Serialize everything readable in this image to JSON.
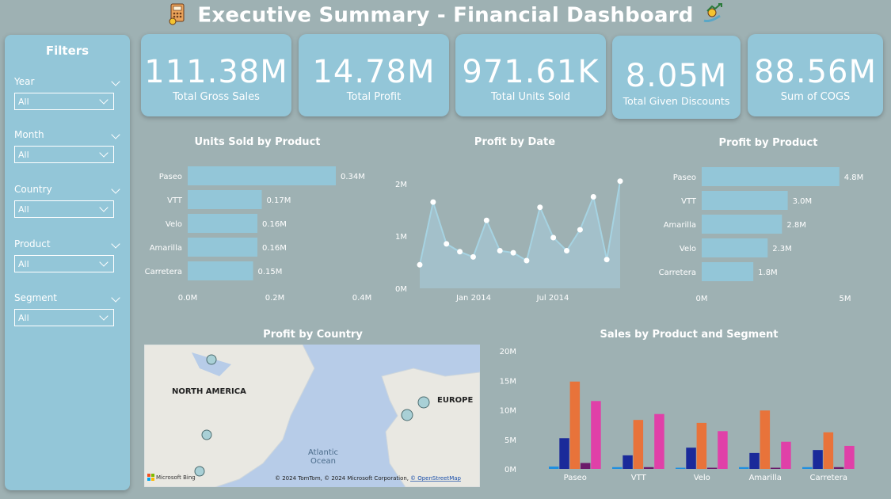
{
  "header": {
    "title": "Executive Summary - Financial Dashboard"
  },
  "filters": {
    "title": "Filters",
    "items": [
      {
        "label": "Year",
        "value": "All"
      },
      {
        "label": "Month",
        "value": "All"
      },
      {
        "label": "Country",
        "value": "All"
      },
      {
        "label": "Product",
        "value": "All"
      },
      {
        "label": "Segment",
        "value": "All"
      }
    ]
  },
  "kpis": [
    {
      "value": "111.38M",
      "label": "Total Gross Sales"
    },
    {
      "value": "14.78M",
      "label": "Total Profit"
    },
    {
      "value": "971.61K",
      "label": "Total Units Sold"
    },
    {
      "value": "8.05M",
      "label": "Total Given Discounts"
    },
    {
      "value": "88.56M",
      "label": "Sum of COGS"
    }
  ],
  "colors": {
    "bar": "#93c6d8",
    "card": "#93c6d8",
    "background": "#9eb1b3",
    "segments": [
      "#1f8fe0",
      "#1a2a9a",
      "#e8733a",
      "#6b1a6a",
      "#e040a8"
    ]
  },
  "chart_data": [
    {
      "type": "bar",
      "orientation": "horizontal",
      "title": "Units Sold by Product",
      "categories": [
        "Paseo",
        "VTT",
        "Velo",
        "Amarilla",
        "Carretera"
      ],
      "values": [
        0.34,
        0.17,
        0.16,
        0.16,
        0.15
      ],
      "value_labels": [
        "0.34M",
        "0.17M",
        "0.16M",
        "0.16M",
        "0.15M"
      ],
      "xlim": [
        0,
        0.4
      ],
      "ticks": [
        "0.0M",
        "0.2M",
        "0.4M"
      ]
    },
    {
      "type": "area",
      "title": "Profit by Date",
      "values": [
        0.45,
        1.65,
        0.85,
        0.7,
        0.6,
        1.3,
        0.72,
        0.68,
        0.53,
        1.55,
        0.97,
        0.72,
        1.12,
        1.75,
        0.55,
        2.05
      ],
      "ylim": [
        0,
        2.2
      ],
      "yticks": [
        "0M",
        "1M",
        "2M"
      ],
      "xticks": [
        "Jan 2014",
        "Jul 2014"
      ]
    },
    {
      "type": "bar",
      "orientation": "horizontal",
      "title": "Profit by Product",
      "categories": [
        "Paseo",
        "VTT",
        "Amarilla",
        "Velo",
        "Carretera"
      ],
      "values": [
        4.8,
        3.0,
        2.8,
        2.3,
        1.8
      ],
      "value_labels": [
        "4.8M",
        "3.0M",
        "2.8M",
        "2.3M",
        "1.8M"
      ],
      "xlim": [
        0,
        5
      ],
      "ticks": [
        "0M",
        "5M"
      ]
    },
    {
      "type": "map",
      "title": "Profit by Country",
      "labels": [
        "NORTH AMERICA",
        "EUROPE",
        "Atlantic",
        "Ocean"
      ],
      "attribution": "© 2024 TomTom, © 2024 Microsoft Corporation,",
      "attribution_link": "© OpenStreetMap",
      "logo": "Microsoft Bing"
    },
    {
      "type": "bar",
      "title": "Sales by Product and Segment",
      "categories": [
        "Paseo",
        "VTT",
        "Velo",
        "Amarilla",
        "Carretera"
      ],
      "series": [
        {
          "values": [
            0.4,
            0.3,
            0.2,
            0.3,
            0.3
          ]
        },
        {
          "values": [
            5.2,
            2.3,
            3.6,
            2.7,
            3.2
          ]
        },
        {
          "values": [
            14.8,
            8.3,
            7.8,
            9.9,
            6.2
          ]
        },
        {
          "values": [
            1.0,
            0.3,
            0.2,
            0.2,
            0.3
          ]
        },
        {
          "values": [
            11.5,
            9.3,
            6.4,
            4.6,
            3.9
          ]
        }
      ],
      "ylim": [
        0,
        20
      ],
      "yticks": [
        "0M",
        "5M",
        "10M",
        "15M",
        "20M"
      ]
    }
  ]
}
